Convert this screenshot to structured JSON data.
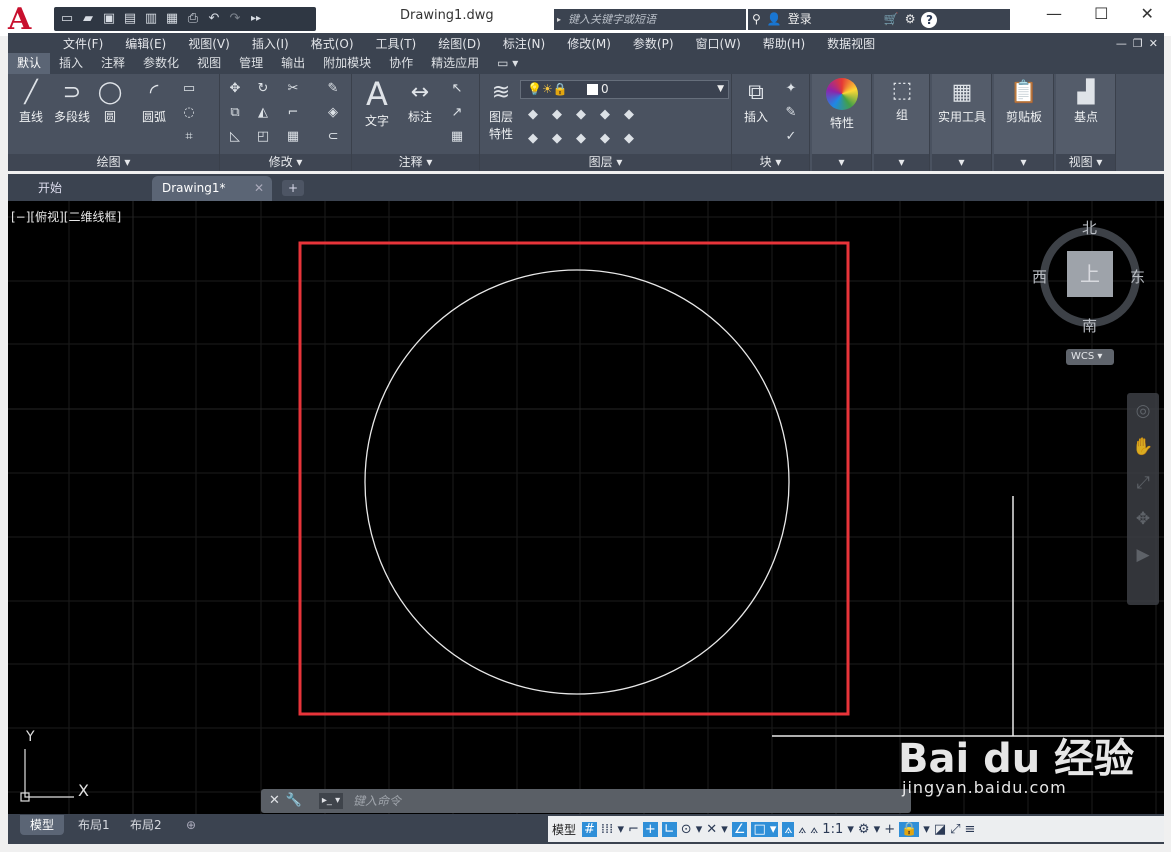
{
  "app": {
    "logo_letter": "A",
    "doc_title": "Drawing1.dwg"
  },
  "qat_icons": [
    "new-icon",
    "open-icon",
    "save-icon",
    "saveas-icon",
    "publish-icon",
    "cloud-icon",
    "print-icon",
    "undo-icon",
    "redo-icon",
    "more-icon"
  ],
  "search": {
    "placeholder": "键入关键字或短语"
  },
  "account": {
    "login_label": "登录"
  },
  "menu": [
    "文件(F)",
    "编辑(E)",
    "视图(V)",
    "插入(I)",
    "格式(O)",
    "工具(T)",
    "绘图(D)",
    "标注(N)",
    "修改(M)",
    "参数(P)",
    "窗口(W)",
    "帮助(H)",
    "数据视图"
  ],
  "ribbon_tabs": [
    "默认",
    "插入",
    "注释",
    "参数化",
    "视图",
    "管理",
    "输出",
    "附加模块",
    "协作",
    "精选应用"
  ],
  "active_ribbon_tab": "默认",
  "draw_panel": {
    "line": "直线",
    "polyline": "多段线",
    "circle": "圆",
    "arc": "圆弧",
    "label": "绘图"
  },
  "modify_panel": {
    "label": "修改"
  },
  "annotation_panel": {
    "text": "文字",
    "dimension": "标注",
    "label": "注释"
  },
  "layers_panel": {
    "properties_line1": "图层",
    "properties_line2": "特性",
    "current_layer": "0",
    "label": "图层"
  },
  "block_panel": {
    "insert": "插入",
    "label": "块"
  },
  "properties_panel": {
    "label": "特性"
  },
  "groups_panel": {
    "label": "组"
  },
  "utilities_panel": {
    "label": "实用工具"
  },
  "clipboard_panel": {
    "label": "剪贴板"
  },
  "view_panel": {
    "base": "基点",
    "label": "视图"
  },
  "file_tabs": [
    {
      "label": "开始"
    },
    {
      "label": "Drawing1*"
    }
  ],
  "viewport": {
    "label": "[−][俯视][二维线框]"
  },
  "viewcube": {
    "north": "北",
    "south": "南",
    "east": "东",
    "west": "西",
    "top": "上",
    "wcs": "WCS"
  },
  "ucs": {
    "x": "X",
    "y": "Y"
  },
  "command_line": {
    "placeholder": "键入命令"
  },
  "watermark": {
    "brand": "Bai du 经验",
    "url": "jingyan.baidu.com"
  },
  "layout_tabs": [
    "模型",
    "布局1",
    "布局2"
  ],
  "active_layout": "模型",
  "status": {
    "model_label": "模型",
    "scale": "1:1"
  }
}
